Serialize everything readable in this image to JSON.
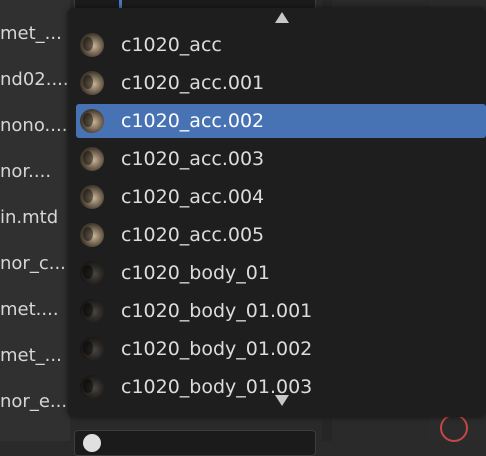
{
  "left_panel": {
    "items": [
      "met_...",
      "nd02....",
      "nono....",
      "nor....",
      "in.mtd",
      "nor_c...",
      "met....",
      "met_...",
      "nor_e..."
    ]
  },
  "dropdown": {
    "items": [
      {
        "label": "c1020_acc",
        "selected": false
      },
      {
        "label": "c1020_acc.001",
        "selected": false
      },
      {
        "label": "c1020_acc.002",
        "selected": true
      },
      {
        "label": "c1020_acc.003",
        "selected": false
      },
      {
        "label": "c1020_acc.004",
        "selected": false
      },
      {
        "label": "c1020_acc.005",
        "selected": false
      },
      {
        "label": "c1020_body_01",
        "selected": false
      },
      {
        "label": "c1020_body_01.001",
        "selected": false
      },
      {
        "label": "c1020_body_01.002",
        "selected": false
      },
      {
        "label": "c1020_body_01.003",
        "selected": false
      }
    ],
    "icon": "material-preview-icon",
    "scroll_up_icon": "triangle-up-icon",
    "scroll_down_icon": "triangle-down-icon"
  },
  "colors": {
    "selected_bg": "#4772b3",
    "popup_bg": "#1e1e1e",
    "text": "#dcdcdc"
  }
}
